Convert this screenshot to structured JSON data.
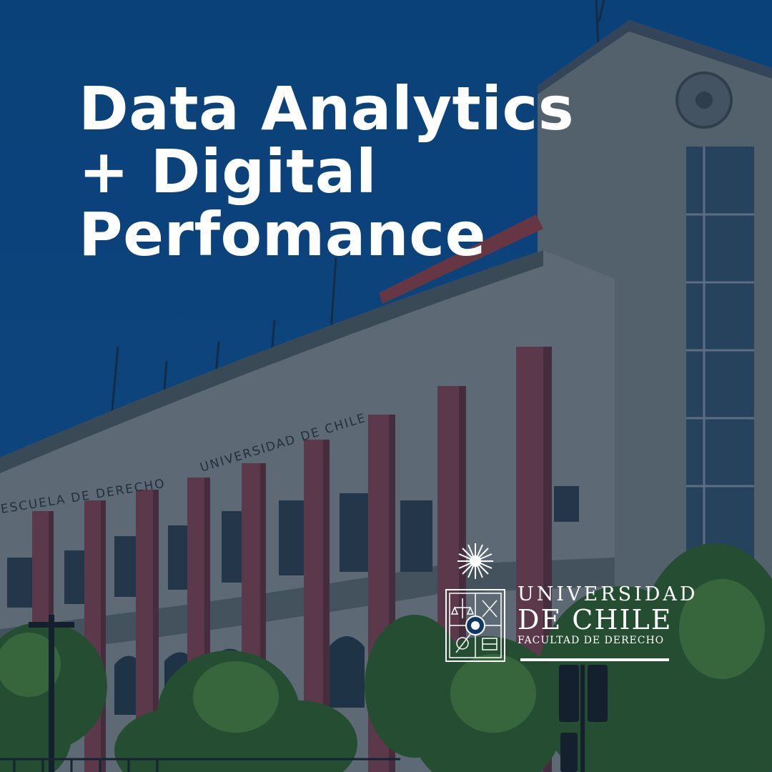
{
  "headline": {
    "line1": "Data Analytics",
    "line2": "+ Digital",
    "line3": "Perfomance"
  },
  "building_inscription": {
    "part1": "ESCUELA  DE  DERECHO",
    "part2": "UNIVERSIDAD  DE  CHILE"
  },
  "logo": {
    "line1": "UNIVERSIDAD",
    "line2": "DE CHILE",
    "line3": "FACULTAD DE DERECHO"
  },
  "colors": {
    "sky": "#0e4a86",
    "overlay": "#0b2c55",
    "headline": "#ffffff",
    "column": "#7a3d45",
    "facade": "#8a8d8c",
    "foliage": "#3d6b2a"
  },
  "icons": [
    "university-crest-icon",
    "star-burst-icon"
  ]
}
